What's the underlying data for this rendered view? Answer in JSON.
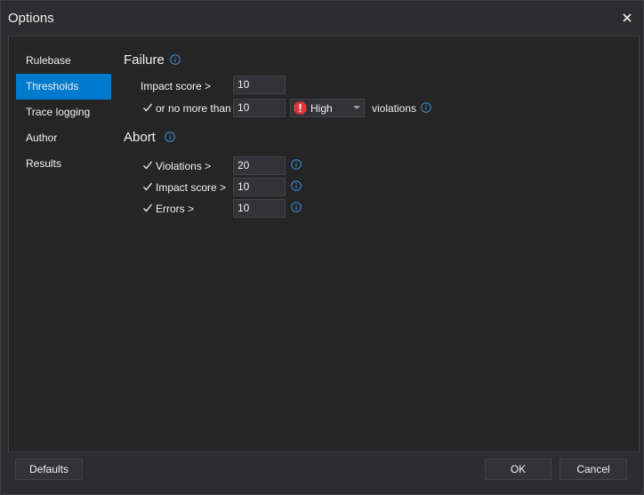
{
  "window": {
    "title": "Options"
  },
  "nav": {
    "items": [
      {
        "label": "Rulebase"
      },
      {
        "label": "Thresholds"
      },
      {
        "label": "Trace logging"
      },
      {
        "label": "Author"
      },
      {
        "label": "Results"
      }
    ],
    "active_index": 1
  },
  "failure": {
    "title": "Failure",
    "impact_score_label": "Impact score >",
    "impact_score_value": "10",
    "or_no_more_than_label": "or no more than",
    "or_no_more_than_checked": true,
    "or_no_more_than_value": "10",
    "severity_selected": "High",
    "violations_label": "violations"
  },
  "abort": {
    "title": "Abort",
    "violations_label": "Violations >",
    "violations_checked": true,
    "violations_value": "20",
    "impact_score_label": "Impact score >",
    "impact_score_checked": true,
    "impact_score_value": "10",
    "errors_label": "Errors >",
    "errors_checked": true,
    "errors_value": "10"
  },
  "footer": {
    "defaults_label": "Defaults",
    "ok_label": "OK",
    "cancel_label": "Cancel"
  },
  "colors": {
    "accent": "#007acc",
    "info_icon": "#3d8fd9",
    "error_icon": "#e0373c"
  },
  "icons": {
    "info": "info-icon",
    "severity": "exclamation-circle-icon",
    "close": "close-icon",
    "check": "check-icon"
  }
}
